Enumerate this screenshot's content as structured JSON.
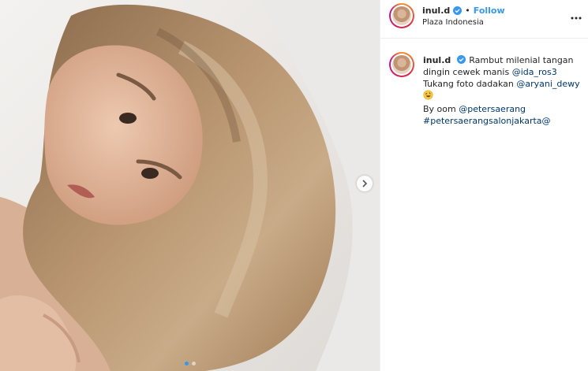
{
  "post": {
    "username": "inul.d",
    "follow_label": "Follow",
    "location": "Plaza Indonesia",
    "separator": "•"
  },
  "caption": {
    "username": "inul.d",
    "line1_text": "Rambut milenial tangan dingin cewek manis ",
    "line1_mention": "@ida_ros3",
    "line2_text": "Tukang foto dadakan ",
    "line2_mention": "@aryani_dewy",
    "emoji": "rolling-on-floor-laughing-emoji",
    "line3_text": "By oom ",
    "line3_mention": "@petersaerang",
    "hashtag": "#petersaerangsalonjakarta@"
  },
  "carousel": {
    "slide_count": 2,
    "active_slide": 1
  },
  "colors": {
    "accent": "#3897f0",
    "link": "#00376b",
    "text": "#262626",
    "border": "#efefef"
  },
  "icons": [
    "verified-badge-icon",
    "more-options-icon",
    "chevron-right-icon"
  ]
}
